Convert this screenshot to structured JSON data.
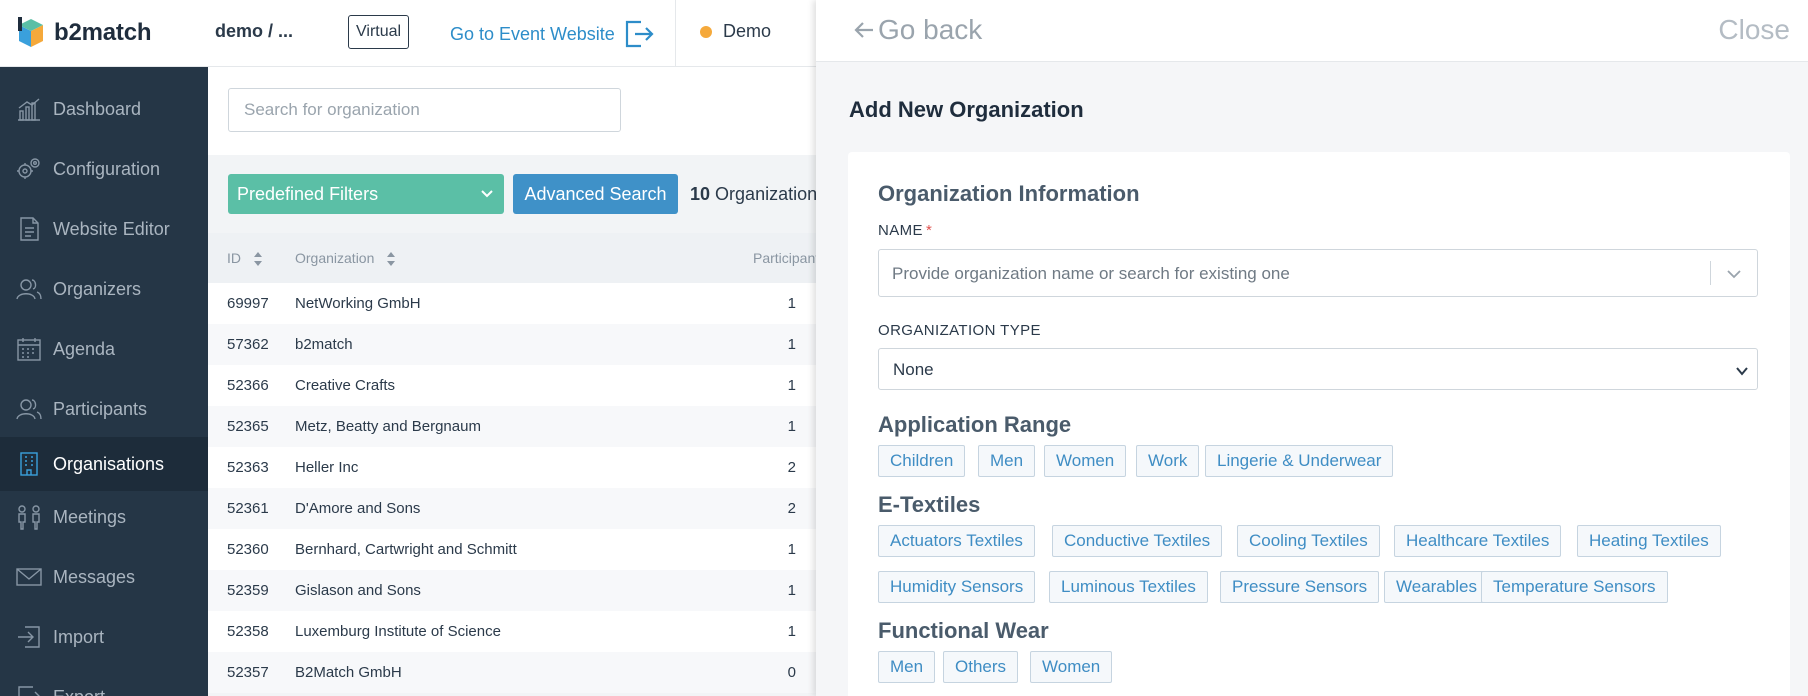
{
  "header": {
    "logo_text": "b2match",
    "event_name": "demo / ...",
    "virtual_badge": "Virtual",
    "website_link": "Go to Event Website",
    "demo_label": "Demo"
  },
  "sidebar": {
    "items": [
      {
        "label": "Dashboard",
        "icon": "dashboard-icon"
      },
      {
        "label": "Configuration",
        "icon": "gears-icon"
      },
      {
        "label": "Website Editor",
        "icon": "document-icon"
      },
      {
        "label": "Organizers",
        "icon": "organizers-icon"
      },
      {
        "label": "Agenda",
        "icon": "calendar-icon"
      },
      {
        "label": "Participants",
        "icon": "participants-icon"
      },
      {
        "label": "Organisations",
        "icon": "building-icon",
        "active": true
      },
      {
        "label": "Meetings",
        "icon": "meetings-icon"
      },
      {
        "label": "Messages",
        "icon": "envelope-icon"
      },
      {
        "label": "Import",
        "icon": "import-icon"
      },
      {
        "label": "Export",
        "icon": "export-icon"
      }
    ]
  },
  "main": {
    "search_placeholder": "Search for organization",
    "predefined_filters": "Predefined Filters",
    "advanced_search": "Advanced Search",
    "count_number": "10",
    "count_label": "Organizations",
    "columns": {
      "id": "ID",
      "organization": "Organization",
      "participants": "Participants"
    },
    "rows": [
      {
        "id": "69997",
        "name": "NetWorking GmbH",
        "participants": "1"
      },
      {
        "id": "57362",
        "name": "b2match",
        "participants": "1"
      },
      {
        "id": "52366",
        "name": "Creative Crafts",
        "participants": "1"
      },
      {
        "id": "52365",
        "name": "Metz, Beatty and Bergnaum",
        "participants": "1"
      },
      {
        "id": "52363",
        "name": "Heller Inc",
        "participants": "2"
      },
      {
        "id": "52361",
        "name": "D'Amore and Sons",
        "participants": "2"
      },
      {
        "id": "52360",
        "name": "Bernhard, Cartwright and Schmitt",
        "participants": "1"
      },
      {
        "id": "52359",
        "name": "Gislason and Sons",
        "participants": "1"
      },
      {
        "id": "52358",
        "name": "Luxemburg Institute of Science",
        "participants": "1"
      },
      {
        "id": "52357",
        "name": "B2Match GmbH",
        "participants": "0"
      }
    ]
  },
  "panel": {
    "go_back": "Go back",
    "close": "Close",
    "title": "Add New Organization",
    "section_title": "Organization Information",
    "name_label": "NAME",
    "name_required": "*",
    "name_placeholder": "Provide organization name or search for existing one",
    "type_label": "ORGANIZATION TYPE",
    "type_value": "None",
    "groups": [
      {
        "title": "Application Range",
        "tags": [
          "Children",
          "Men",
          "Women",
          "Work",
          "Lingerie & Underwear"
        ]
      },
      {
        "title": "E-Textiles",
        "tags": [
          "Actuators Textiles",
          "Conductive Textiles",
          "Cooling Textiles",
          "Healthcare Textiles",
          "Heating Textiles",
          "Humidity Sensors",
          "Luminous Textiles",
          "Pressure Sensors",
          "Wearables",
          "Temperature Sensors"
        ]
      },
      {
        "title": "Functional Wear",
        "tags": [
          "Men",
          "Others",
          "Women"
        ]
      }
    ]
  },
  "colors": {
    "sidebar_bg": "#253646",
    "accent_blue": "#3f91c8",
    "filters_green": "#5bbfa6",
    "tag_text": "#3f8dc4",
    "demo_dot": "#f5a93b"
  }
}
